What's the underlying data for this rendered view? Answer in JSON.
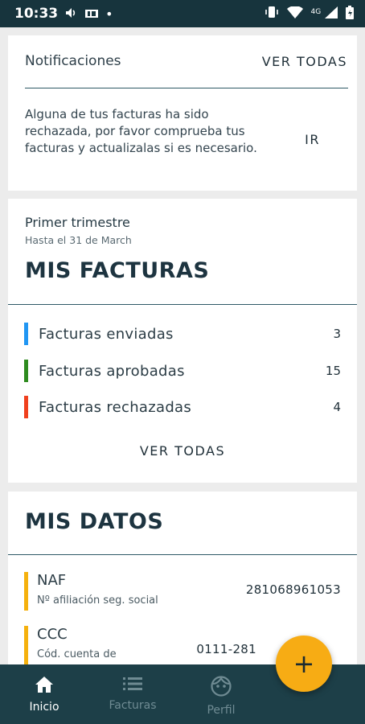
{
  "status_bar": {
    "time": "10:33",
    "network": "4G"
  },
  "notifications": {
    "title": "Notificaciones",
    "view_all_label": "VER TODAS",
    "message": "Alguna de tus facturas ha sido rechazada, por favor comprueba tus facturas y actualizalas si es necesario.",
    "action_label": "IR"
  },
  "invoices": {
    "period": "Primer trimestre",
    "until": "Hasta el 31 de March",
    "title": "MIS FACTURAS",
    "rows": [
      {
        "label": "Facturas enviadas",
        "count": "3",
        "color": "#2196f3"
      },
      {
        "label": "Facturas aprobadas",
        "count": "15",
        "color": "#2e8b1f"
      },
      {
        "label": "Facturas rechazadas",
        "count": "4",
        "color": "#f0401e"
      }
    ],
    "view_all_label": "VER TODAS"
  },
  "my_data": {
    "title": "MIS DATOS",
    "rows": [
      {
        "name": "NAF",
        "description": "Nº afiliación seg. social",
        "value": "281068961053"
      },
      {
        "name": "CCC",
        "description": "Cód. cuenta de",
        "value": "0111-281"
      }
    ],
    "accent_color": "#f5b10e"
  },
  "fab": {
    "label": "+",
    "color": "#f7ac14"
  },
  "bottom_nav": {
    "items": [
      {
        "label": "Inicio",
        "icon": "home-icon",
        "active": true
      },
      {
        "label": "Facturas",
        "icon": "list-icon",
        "active": false
      },
      {
        "label": "Perfil",
        "icon": "face-icon",
        "active": false
      }
    ]
  }
}
